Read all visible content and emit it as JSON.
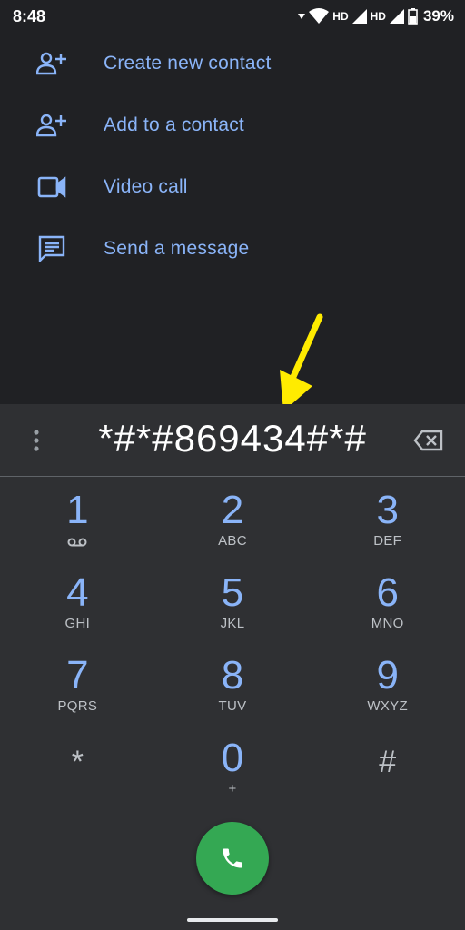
{
  "status_bar": {
    "time": "8:48",
    "hd1": "HD",
    "hd2": "HD",
    "battery": "39%"
  },
  "actions": [
    {
      "label": "Create new contact",
      "icon": "add-person-icon"
    },
    {
      "label": "Add to a contact",
      "icon": "add-person-icon"
    },
    {
      "label": "Video call",
      "icon": "video-camera-icon"
    },
    {
      "label": "Send a message",
      "icon": "message-icon"
    }
  ],
  "dialer": {
    "digits": "*#*#869434#*#"
  },
  "keypad": [
    [
      {
        "digit": "1",
        "letters": ""
      },
      {
        "digit": "2",
        "letters": "ABC"
      },
      {
        "digit": "3",
        "letters": "DEF"
      }
    ],
    [
      {
        "digit": "4",
        "letters": "GHI"
      },
      {
        "digit": "5",
        "letters": "JKL"
      },
      {
        "digit": "6",
        "letters": "MNO"
      }
    ],
    [
      {
        "digit": "7",
        "letters": "PQRS"
      },
      {
        "digit": "8",
        "letters": "TUV"
      },
      {
        "digit": "9",
        "letters": "WXYZ"
      }
    ],
    [
      {
        "digit": "*",
        "letters": ""
      },
      {
        "digit": "0",
        "letters": "+"
      },
      {
        "digit": "#",
        "letters": ""
      }
    ]
  ],
  "colors": {
    "background": "#202124",
    "dialpad": "#2f3033",
    "accent": "#8ab4f8",
    "call": "#34a853",
    "arrow": "#ffeb00"
  }
}
